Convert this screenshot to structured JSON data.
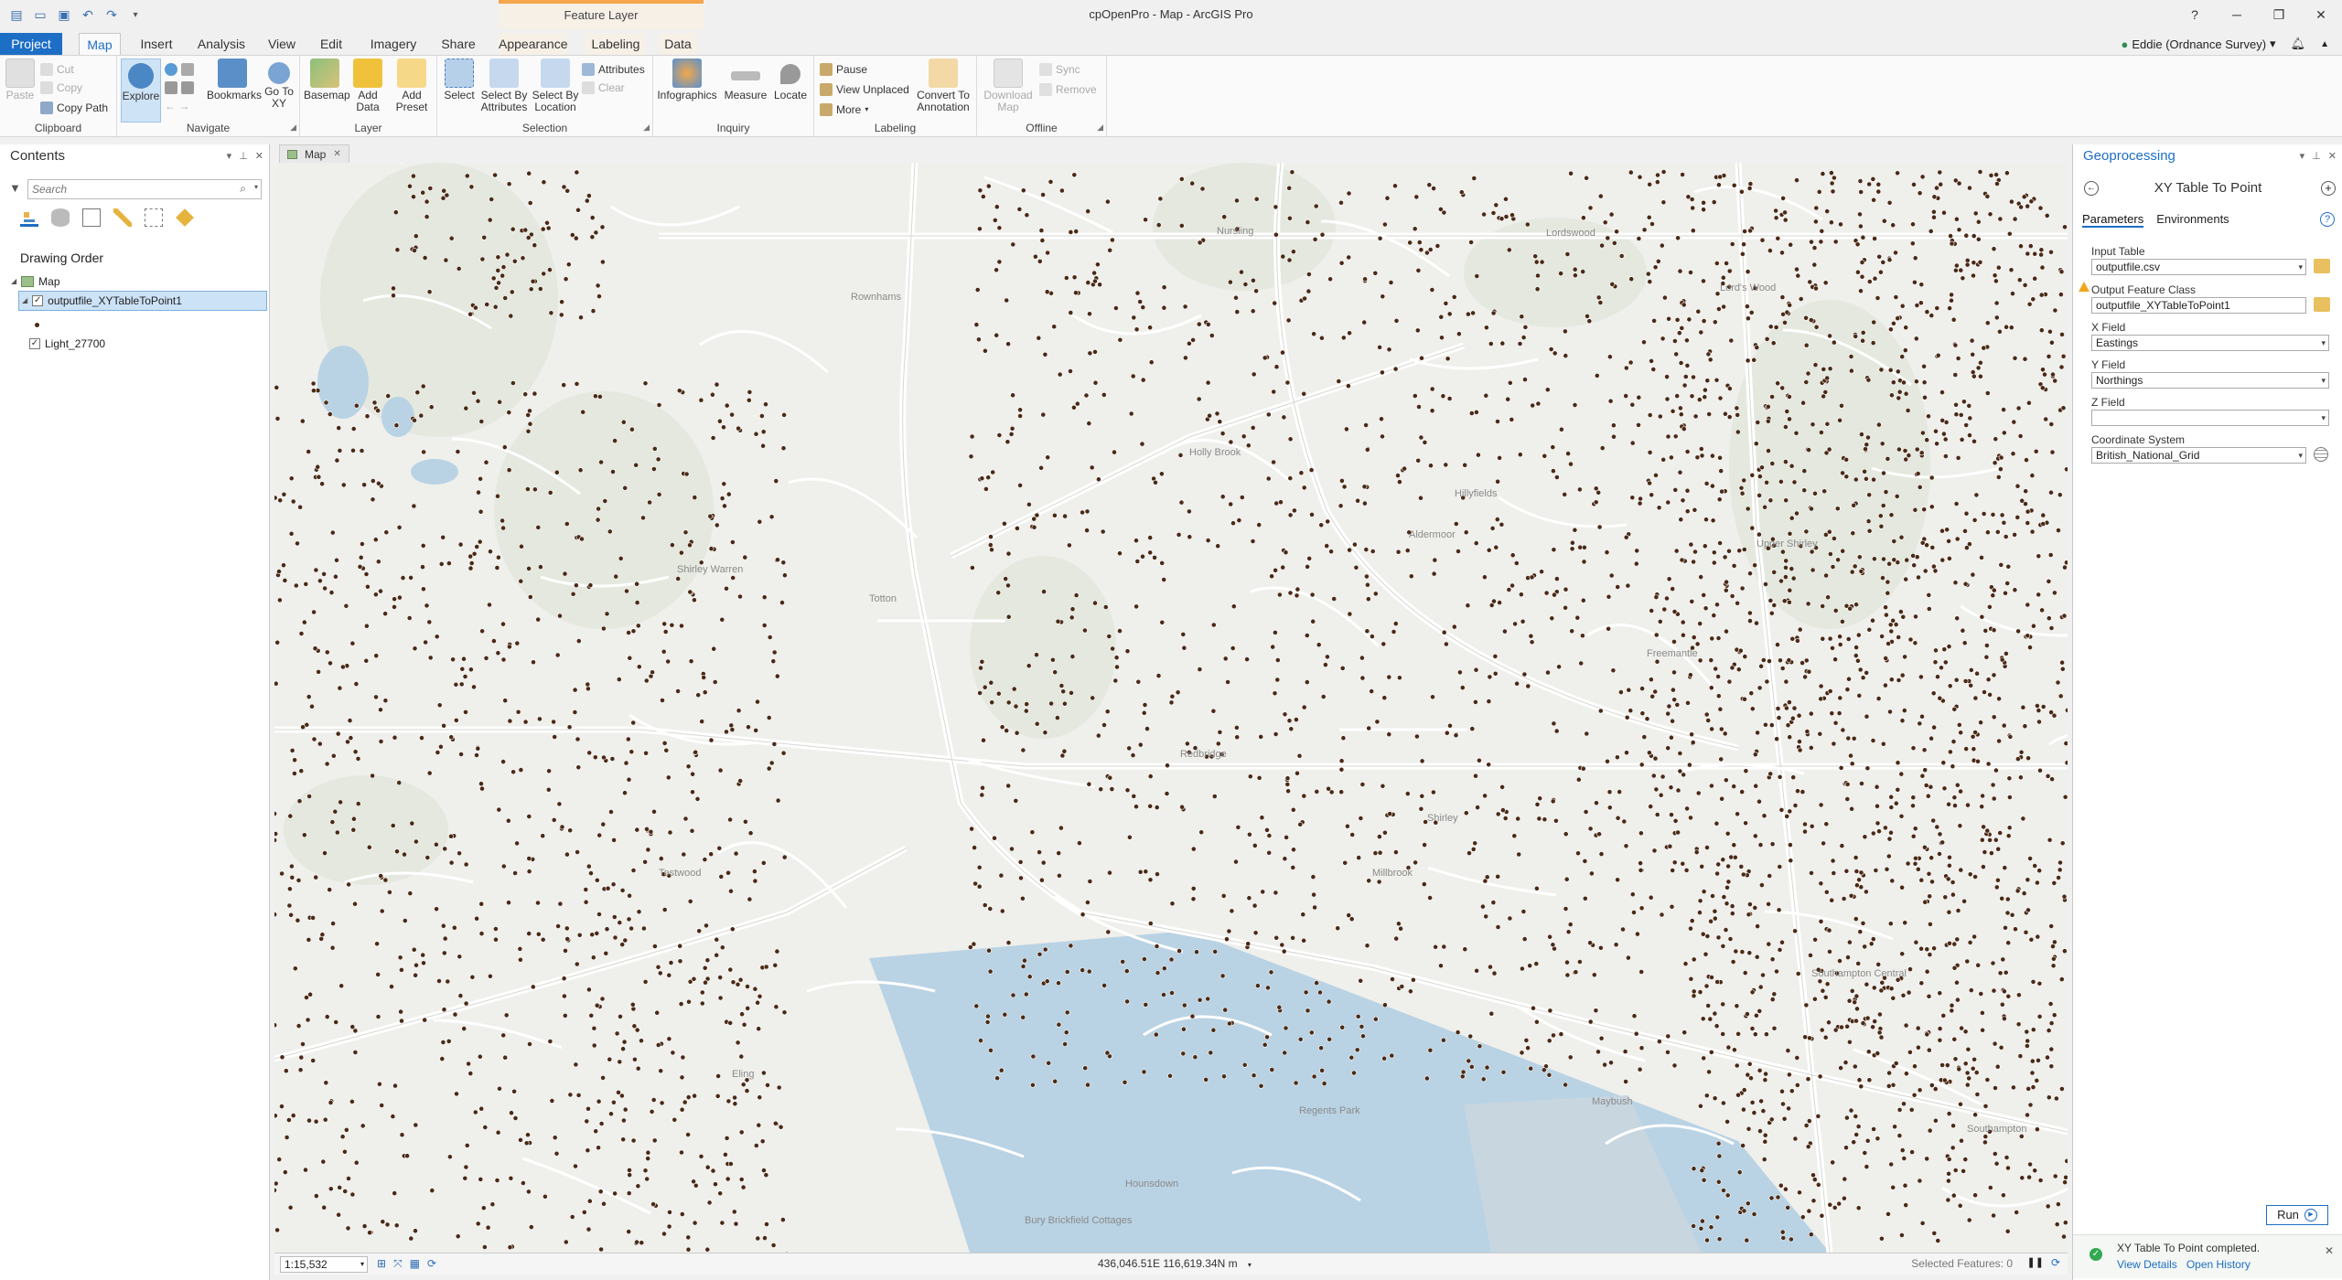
{
  "titlebar": {
    "title": "cpOpenPro - Map - ArcGIS Pro",
    "feature_layer_context": "Feature Layer",
    "help": "?",
    "minimize": "─",
    "restore": "❐",
    "close": "✕"
  },
  "tabs": [
    "Project",
    "Map",
    "Insert",
    "Analysis",
    "View",
    "Edit",
    "Imagery",
    "Share",
    "Appearance",
    "Labeling",
    "Data"
  ],
  "user": {
    "name": "Eddie (Ordnance Survey)",
    "dropdown": "▾"
  },
  "ribbon": {
    "clipboard": {
      "paste": "Paste",
      "cut": "Cut",
      "copy": "Copy",
      "copy_path": "Copy Path",
      "label": "Clipboard"
    },
    "navigate": {
      "explore": "Explore",
      "bookmarks": "Bookmarks",
      "goto_xy": "Go To XY",
      "label": "Navigate"
    },
    "layer": {
      "basemap": "Basemap",
      "add_data": "Add Data",
      "add_preset": "Add Preset",
      "label": "Layer"
    },
    "selection": {
      "select": "Select",
      "by_attributes": "Select By Attributes",
      "by_location": "Select By Location",
      "attributes": "Attributes",
      "clear": "Clear",
      "label": "Selection"
    },
    "inquiry": {
      "infographics": "Infographics",
      "measure": "Measure",
      "locate": "Locate",
      "label": "Inquiry"
    },
    "labeling": {
      "pause": "Pause",
      "view_unplaced": "View Unplaced",
      "more": "More",
      "convert": "Convert To Annotation",
      "label": "Labeling"
    },
    "offline": {
      "download_map": "Download Map",
      "sync": "Sync",
      "remove": "Remove",
      "label": "Offline"
    }
  },
  "contents": {
    "title": "Contents",
    "search_placeholder": "Search",
    "drawing_order": "Drawing Order",
    "layers": [
      {
        "name": "Map"
      },
      {
        "name": "outputfile_XYTableToPoint1"
      },
      {
        "name": "Light_27700"
      }
    ]
  },
  "map": {
    "tab_label": "Map",
    "place_labels": [
      "Nursling",
      "Lordswood",
      "Lord's Wood",
      "Holly Brook",
      "Hillyfields",
      "Aldermoor",
      "Upper Shirley",
      "Shirley Warren",
      "Redbridge",
      "Rownhams",
      "Totton",
      "Testwood",
      "Shirley",
      "Millbrook",
      "Southampton Central",
      "Southampton",
      "Eling",
      "Freemantle",
      "Maybush",
      "Regents Park",
      "Hounsdown",
      "Bury Brickfield Cottages"
    ],
    "scale": "1:15,532",
    "coordinates": "436,046.51E 116,619.34N m",
    "selected_features": "Selected Features: 0"
  },
  "geoprocessing": {
    "title": "Geoprocessing",
    "tool_title": "XY Table To Point",
    "tabs": [
      "Parameters",
      "Environments"
    ],
    "params": {
      "input_table": {
        "label": "Input Table",
        "value": "outputfile.csv"
      },
      "output_fc": {
        "label": "Output Feature Class",
        "value": "outputfile_XYTableToPoint1"
      },
      "x_field": {
        "label": "X Field",
        "value": "Eastings"
      },
      "y_field": {
        "label": "Y Field",
        "value": "Northings"
      },
      "z_field": {
        "label": "Z Field",
        "value": ""
      },
      "coord_sys": {
        "label": "Coordinate System",
        "value": "British_National_Grid"
      }
    },
    "run": "Run",
    "message": "XY Table To Point completed.",
    "view_details": "View Details",
    "open_history": "Open History"
  },
  "colors": {
    "accent": "#1d6ec5",
    "point": "#4a2a16",
    "context_tab": "#f5a54b"
  }
}
